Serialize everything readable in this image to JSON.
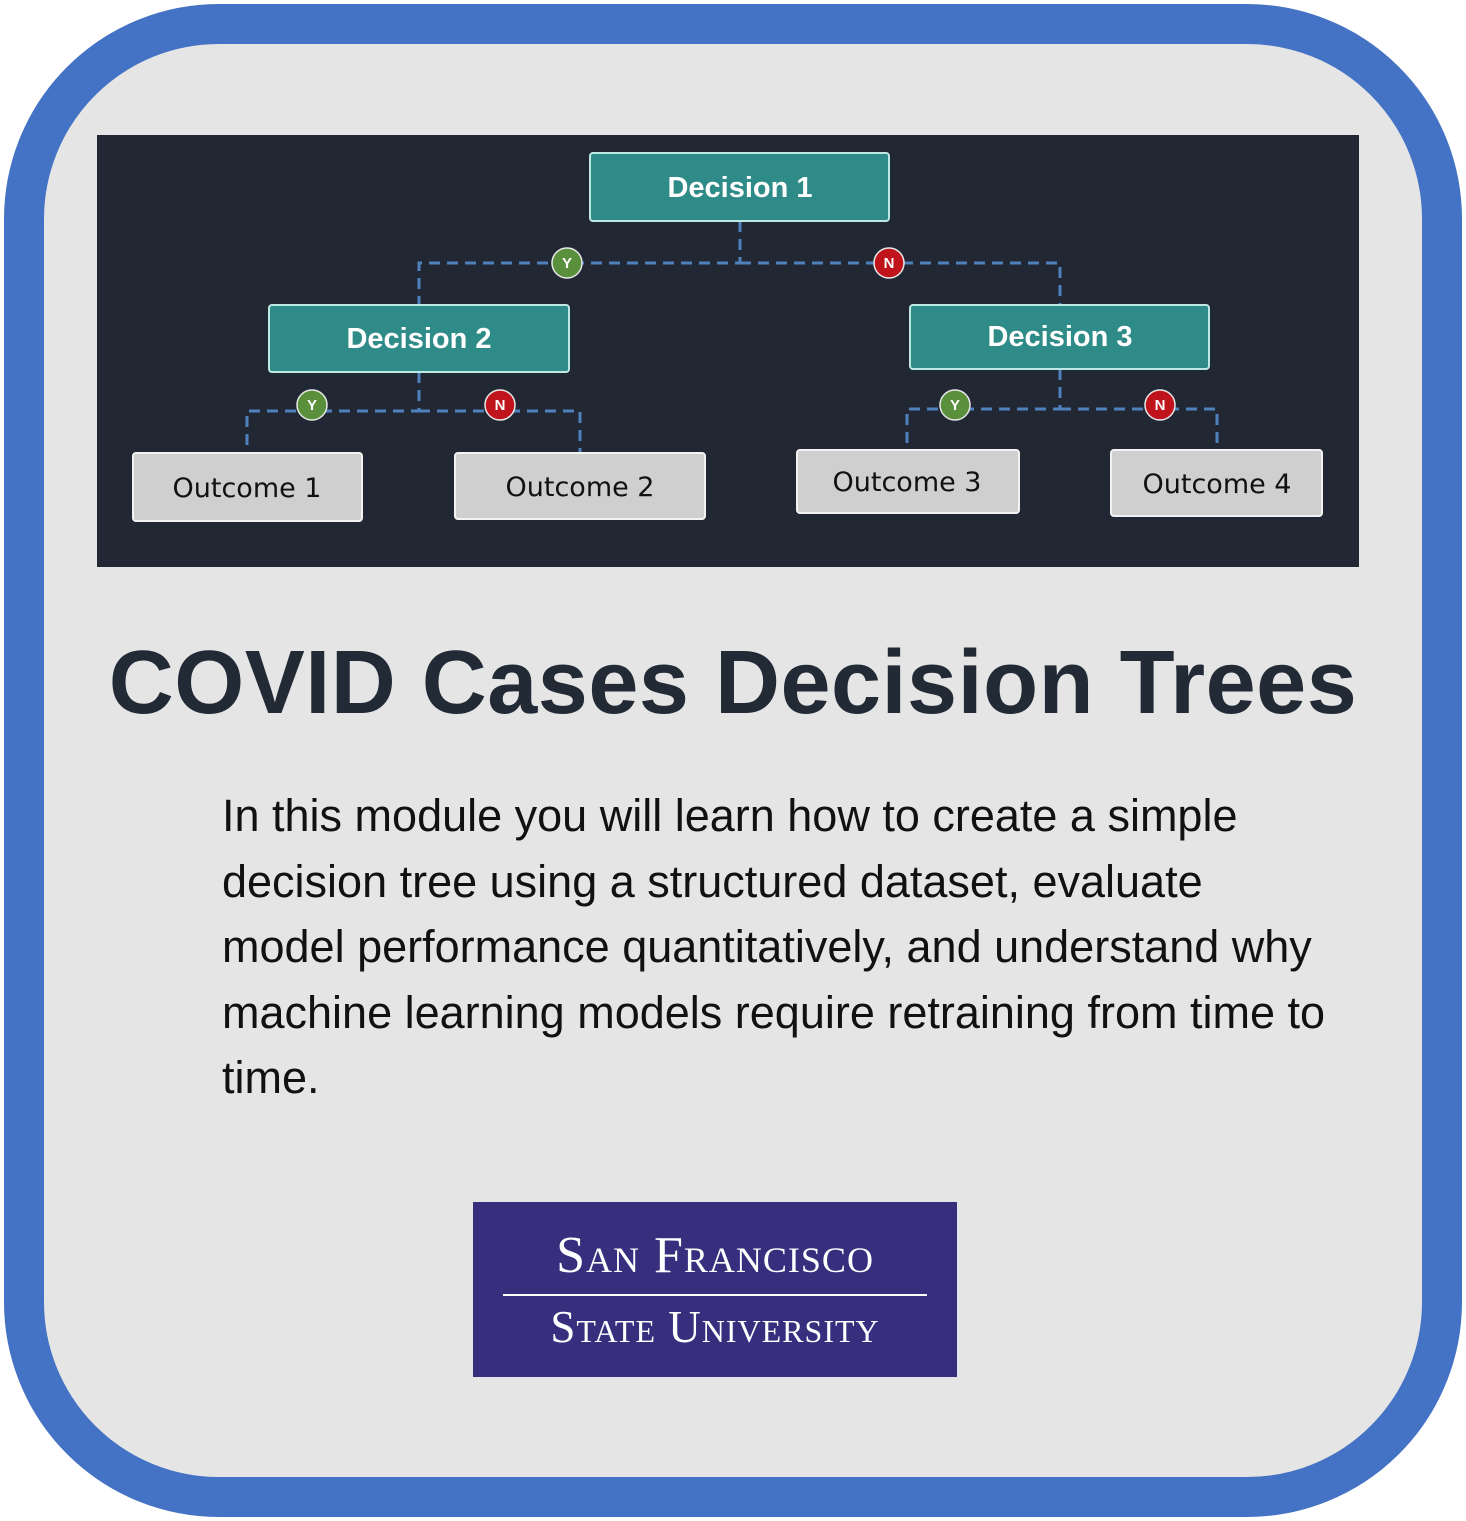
{
  "tree": {
    "decisions": [
      "Decision 1",
      "Decision 2",
      "Decision 3"
    ],
    "outcomes": [
      "Outcome 1",
      "Outcome 2",
      "Outcome 3",
      "Outcome 4"
    ],
    "yes_label": "Y",
    "no_label": "N"
  },
  "title": "COVID Cases Decision Trees",
  "description": "In this module you will learn how to create a simple decision tree using a structured dataset, evaluate model performance quantitatively, and understand why machine learning models require retraining from time to time.",
  "logo": {
    "line1": "San Francisco",
    "line2": "State University"
  },
  "colors": {
    "frame": "#4472c4",
    "card_background": "#e5e5e5",
    "panel_background": "#212833",
    "decision_node": "#2e8b87",
    "outcome_node": "#cfcfcf",
    "yes_badge": "#5a8f3c",
    "no_badge": "#c0141c",
    "logo_background": "#372f7e",
    "title_text": "#222a35"
  }
}
